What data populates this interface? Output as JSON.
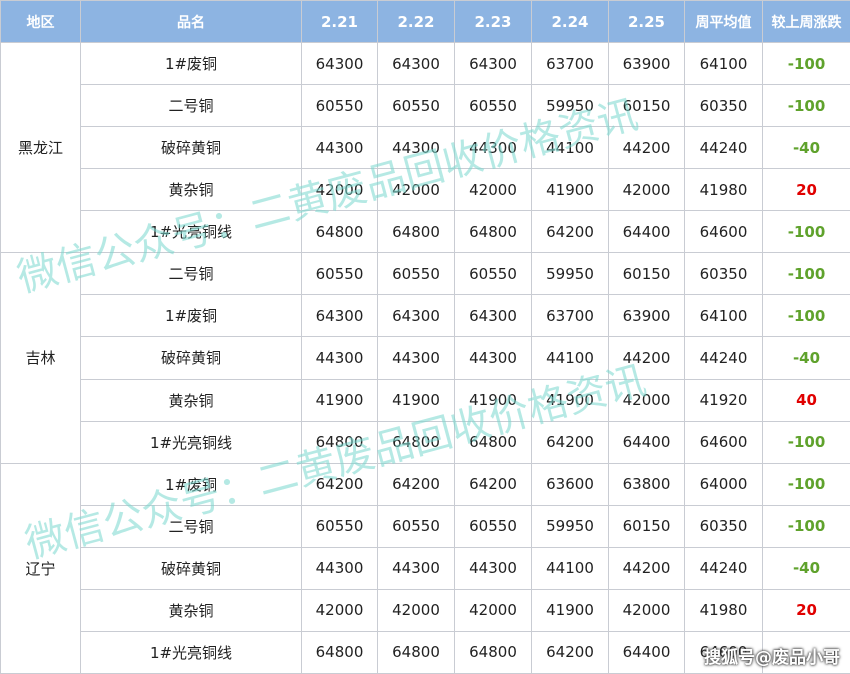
{
  "header": {
    "region": "地区",
    "product": "品名",
    "dates": [
      "2.21",
      "2.22",
      "2.23",
      "2.24",
      "2.25"
    ],
    "weekly_avg": "周平均值",
    "weekly_change": "较上周涨跌"
  },
  "regions": [
    {
      "name": "黑龙江",
      "rows": [
        {
          "product": "1#废铜",
          "values": [
            "64300",
            "64300",
            "64300",
            "63700",
            "63900"
          ],
          "avg": "64100",
          "change": "-100"
        },
        {
          "product": "二号铜",
          "values": [
            "60550",
            "60550",
            "60550",
            "59950",
            "60150"
          ],
          "avg": "60350",
          "change": "-100"
        },
        {
          "product": "破碎黄铜",
          "values": [
            "44300",
            "44300",
            "44300",
            "44100",
            "44200"
          ],
          "avg": "44240",
          "change": "-40"
        },
        {
          "product": "黄杂铜",
          "values": [
            "42000",
            "42000",
            "42000",
            "41900",
            "42000"
          ],
          "avg": "41980",
          "change": "20"
        },
        {
          "product": "1#光亮铜线",
          "values": [
            "64800",
            "64800",
            "64800",
            "64200",
            "64400"
          ],
          "avg": "64600",
          "change": "-100"
        }
      ]
    },
    {
      "name": "吉林",
      "rows": [
        {
          "product": "二号铜",
          "values": [
            "60550",
            "60550",
            "60550",
            "59950",
            "60150"
          ],
          "avg": "60350",
          "change": "-100"
        },
        {
          "product": "1#废铜",
          "values": [
            "64300",
            "64300",
            "64300",
            "63700",
            "63900"
          ],
          "avg": "64100",
          "change": "-100"
        },
        {
          "product": "破碎黄铜",
          "values": [
            "44300",
            "44300",
            "44300",
            "44100",
            "44200"
          ],
          "avg": "44240",
          "change": "-40"
        },
        {
          "product": "黄杂铜",
          "values": [
            "41900",
            "41900",
            "41900",
            "41900",
            "42000"
          ],
          "avg": "41920",
          "change": "40"
        },
        {
          "product": "1#光亮铜线",
          "values": [
            "64800",
            "64800",
            "64800",
            "64200",
            "64400"
          ],
          "avg": "64600",
          "change": "-100"
        }
      ]
    },
    {
      "name": "辽宁",
      "rows": [
        {
          "product": "1#废铜",
          "values": [
            "64200",
            "64200",
            "64200",
            "63600",
            "63800"
          ],
          "avg": "64000",
          "change": "-100"
        },
        {
          "product": "二号铜",
          "values": [
            "60550",
            "60550",
            "60550",
            "59950",
            "60150"
          ],
          "avg": "60350",
          "change": "-100"
        },
        {
          "product": "破碎黄铜",
          "values": [
            "44300",
            "44300",
            "44300",
            "44100",
            "44200"
          ],
          "avg": "44240",
          "change": "-40"
        },
        {
          "product": "黄杂铜",
          "values": [
            "42000",
            "42000",
            "42000",
            "41900",
            "42000"
          ],
          "avg": "41980",
          "change": "20"
        },
        {
          "product": "1#光亮铜线",
          "values": [
            "64800",
            "64800",
            "64800",
            "64200",
            "64400"
          ],
          "avg": "64600",
          "change": ""
        }
      ]
    }
  ],
  "watermark": "微信公众号：二黄废品回收价格资讯",
  "credit": "搜狐号@废品小哥",
  "colors": {
    "header_bg": "#8db4e2",
    "negative": "#5fa22c",
    "positive": "#e00000",
    "watermark": "#78d7cd"
  }
}
